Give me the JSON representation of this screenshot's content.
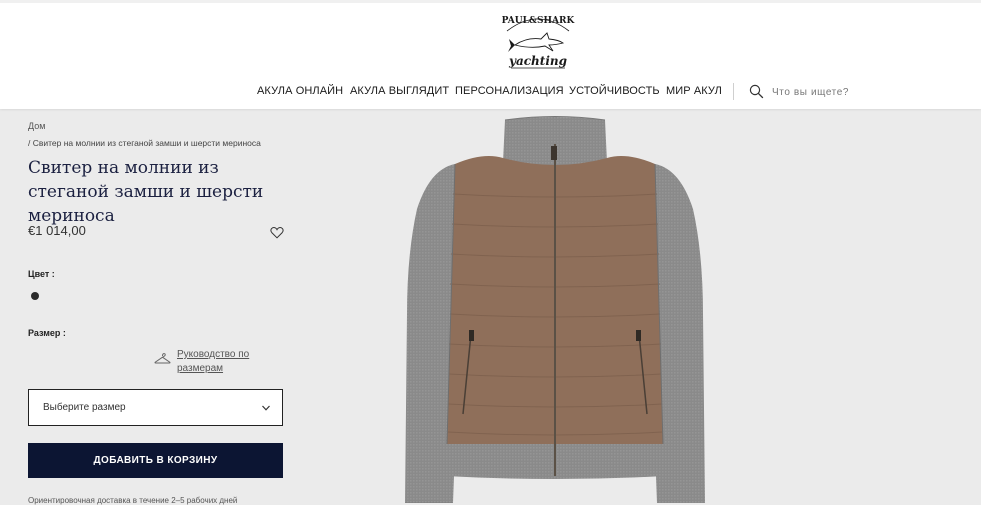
{
  "header": {
    "logo_text": "PAUL & SHARK yachting",
    "nav": [
      {
        "label": "АКУЛА ОНЛАЙН"
      },
      {
        "label": "АКУЛА ВЫГЛЯДИТ"
      },
      {
        "label": "ПЕРСОНАЛИЗАЦИЯ"
      },
      {
        "label": "УСТОЙЧИВОСТЬ"
      },
      {
        "label": "МИР АКУЛ"
      }
    ],
    "search": {
      "placeholder": "Что вы ищете?",
      "icon": "search-icon"
    }
  },
  "breadcrumb": {
    "home": "Дом",
    "current": "/ Свитер на молнии из стеганой замши и шерсти мериноса"
  },
  "product": {
    "title": "Свитер на молнии из стеганой замши и шерсти мериноса",
    "price": "€1 014,00",
    "color_label": "Цвет :",
    "color_swatch": "#2b2b2b",
    "size_label": "Размер :",
    "size_guide": "Руководство по размерам",
    "size_select_placeholder": "Выберите размер",
    "add_to_cart": "ДОБАВИТЬ В КОРЗИНУ",
    "delivery_note": "Ориентировочная доставка в течение 2–5 рабочих дней"
  },
  "colors": {
    "accent": "#0c1533",
    "title": "#1b2040",
    "suede": "#8f6f5a",
    "knit": "#8a8a8a"
  }
}
